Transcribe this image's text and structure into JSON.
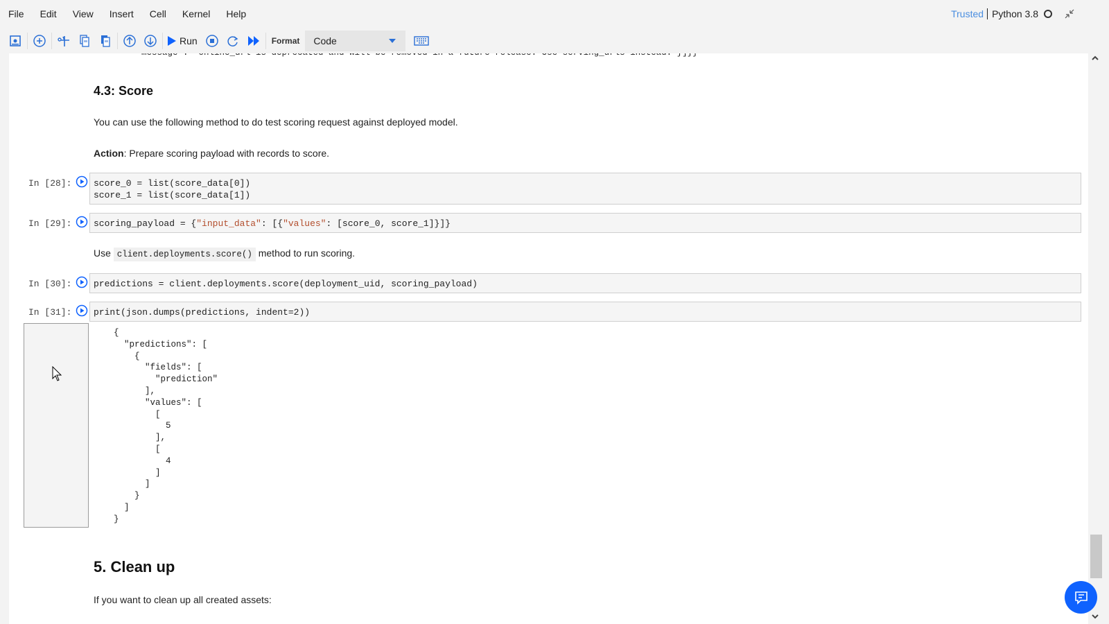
{
  "menubar": {
    "items": [
      "File",
      "Edit",
      "View",
      "Insert",
      "Cell",
      "Kernel",
      "Help"
    ],
    "trusted": "Trusted",
    "kernel": "Python 3.8"
  },
  "toolbar": {
    "run_label": "Run",
    "format_label": "Format",
    "cell_type": "Code",
    "icons": [
      "save-icon",
      "add-cell-icon",
      "cut-icon",
      "copy-icon",
      "paste-icon",
      "move-up-icon",
      "move-down-icon",
      "run-icon",
      "interrupt-icon",
      "restart-icon",
      "run-all-icon",
      "keyboard-icon"
    ]
  },
  "notebook": {
    "truncated_output": "message': 'online_url is deprecated and will be removed in a future release. Use serving_urls instead.'}]}}",
    "section_43_title": "4.3: Score",
    "section_43_desc": "You can use the following method to do test scoring request against deployed model.",
    "action_bold": "Action",
    "action_text": ": Prepare scoring payload with records to score.",
    "cells": [
      {
        "prompt": "In [28]:",
        "lines": [
          "score_0 = list(score_data[0])",
          "score_1 = list(score_data[1])"
        ]
      },
      {
        "prompt": "In [29]:",
        "code_pre": "scoring_payload = {",
        "str1": "\"input_data\"",
        "mid": ": [{",
        "str2": "\"values\"",
        "code_post": ": [score_0, score_1]}]}"
      },
      {
        "prompt": "In [30]:",
        "code": "predictions = client.deployments.score(deployment_uid, scoring_payload)"
      },
      {
        "prompt": "In [31]:",
        "code": "print(json.dumps(predictions, indent=2))"
      }
    ],
    "use_text_pre": "Use",
    "use_inline_code": "client.deployments.score()",
    "use_text_post": "method to run scoring.",
    "output_json": "{\n  \"predictions\": [\n    {\n      \"fields\": [\n        \"prediction\"\n      ],\n      \"values\": [\n        [\n          5\n        ],\n        [\n          4\n        ]\n      ]\n    }\n  ]\n}",
    "section_5_title": "5. Clean up",
    "section_5_desc": "If you want to clean up all created assets:"
  },
  "colors": {
    "accent": "#0f62fe",
    "trusted": "#4a8ee0",
    "icon_blue": "#2a6fd6"
  }
}
